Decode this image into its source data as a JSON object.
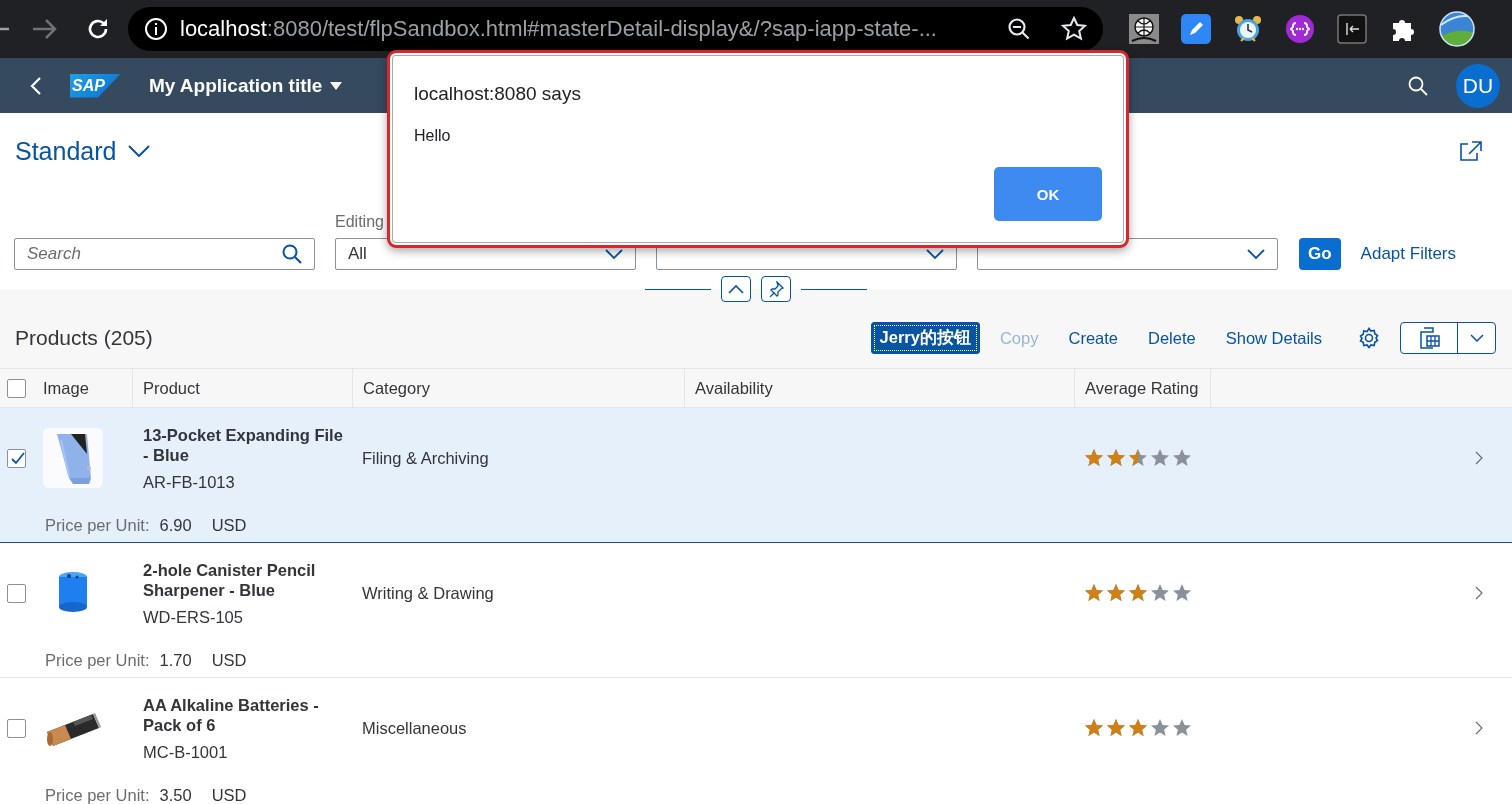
{
  "browser": {
    "url_host": "localhost",
    "url_rest": ":8080/test/flpSandbox.html#masterDetail-display&/?sap-iapp-state-..."
  },
  "shell": {
    "logo": "SAP",
    "title": "My Application title",
    "avatar": "DU"
  },
  "variant": {
    "title": "Standard"
  },
  "filters": {
    "search": {
      "placeholder": "Search"
    },
    "fields": [
      {
        "kind": "select",
        "label": "Editing",
        "value": "All"
      },
      {
        "kind": "select"
      },
      {
        "kind": "select"
      }
    ],
    "go": "Go",
    "adapt": "Adapt Filters"
  },
  "table": {
    "title": "Products (205)",
    "toolbar": [
      {
        "kind": "emphasized",
        "label": "Jerry的按钮",
        "disabled": false
      },
      {
        "kind": "text",
        "label": "Copy",
        "disabled": true
      },
      {
        "kind": "text",
        "label": "Create",
        "disabled": false
      },
      {
        "kind": "text",
        "label": "Delete",
        "disabled": false
      },
      {
        "kind": "text",
        "label": "Show Details",
        "disabled": false
      }
    ],
    "header_checkbox": {
      "checked": false
    },
    "columns": [
      "Image",
      "Product",
      "Category",
      "Availability",
      "Average Rating"
    ],
    "rows": [
      {
        "selected": true,
        "name": "13-Pocket Expanding File - Blue",
        "id": "AR-FB-1013",
        "category": "Filing & Archiving",
        "stars": 2.5,
        "price_label": "Price per Unit:",
        "price": "6.90",
        "currency": "USD"
      },
      {
        "selected": false,
        "name": "2-hole Canister Pencil Sharpener - Blue",
        "id": "WD-ERS-105",
        "category": "Writing & Drawing",
        "stars": 3,
        "price_label": "Price per Unit:",
        "price": "1.70",
        "currency": "USD"
      },
      {
        "selected": false,
        "name": "AA Alkaline Batteries - Pack of 6",
        "id": "MC-B-1001",
        "category": "Miscellaneous",
        "stars": 3,
        "price_label": "Price per Unit:",
        "price": "3.50",
        "currency": "USD"
      }
    ]
  },
  "dialog": {
    "title": "localhost:8080 says",
    "message": "Hello",
    "button": "OK"
  }
}
